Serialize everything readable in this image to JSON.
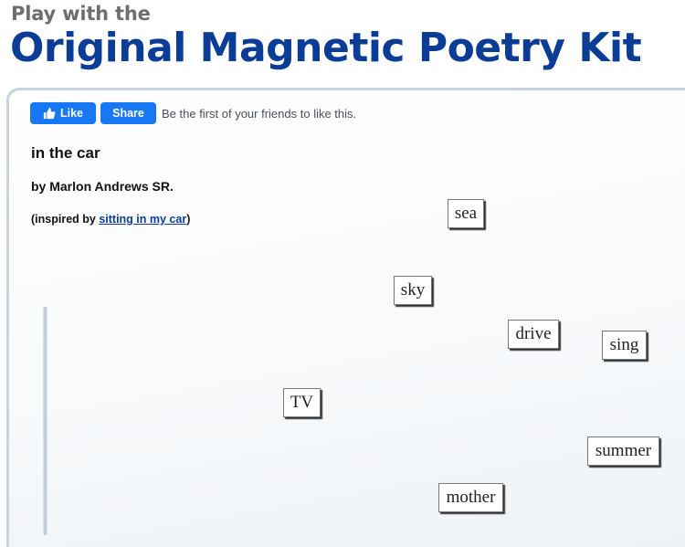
{
  "header": {
    "kicker": "Play with the",
    "title": "Original Magnetic Poetry Kit"
  },
  "facebook": {
    "like_label": "Like",
    "share_label": "Share",
    "social_text": "Be the first of your friends to like this.",
    "icon": "thumbs-up-icon",
    "brand_color": "#1877f2"
  },
  "poem": {
    "title": "in the car",
    "author": "by Marlon Andrews SR.",
    "inspired_prefix": "(inspired by ",
    "inspired_link": "sitting in my car",
    "inspired_suffix": ")"
  },
  "magnets": [
    "sea",
    "sky",
    "drive",
    "sing",
    "TV",
    "summer",
    "mother"
  ],
  "colors": {
    "title_blue": "#0b3c96",
    "kicker_gray": "#6e6e6e"
  }
}
